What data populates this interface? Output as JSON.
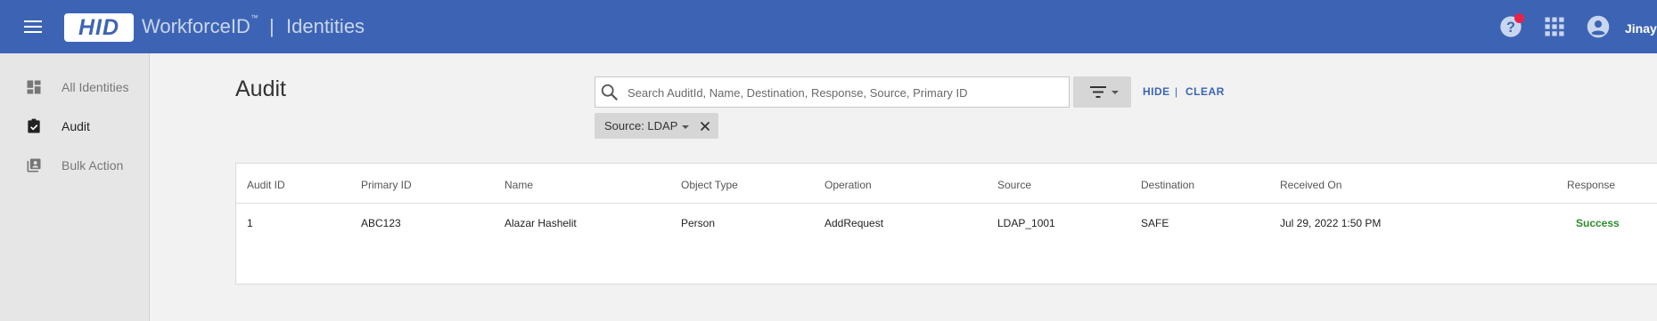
{
  "header": {
    "brand_logo": "HID",
    "product_name": "WorkforceID",
    "trademark": "™",
    "separator": "|",
    "section_title": "Identities",
    "username": "Jinay",
    "icons": [
      "menu-icon",
      "help-icon",
      "apps-grid-icon",
      "account-circle-icon"
    ],
    "notification_color": "#e8234a",
    "bar_color": "#3d64b4"
  },
  "sidebar": {
    "items": [
      {
        "label": "All Identities",
        "icon": "dashboard-icon",
        "active": false
      },
      {
        "label": "Audit",
        "icon": "clipboard-check-icon",
        "active": true
      },
      {
        "label": "Bulk Action",
        "icon": "contacts-icon",
        "active": false
      }
    ]
  },
  "main": {
    "title": "Audit",
    "search": {
      "placeholder": "Search AuditId, Name, Destination, Response, Source, Primary ID",
      "value": ""
    },
    "actions": {
      "hide": "HIDE",
      "separator": "|",
      "clear": "CLEAR"
    },
    "filter_chip": {
      "label": "Source: LDAP"
    },
    "table": {
      "columns": [
        "Audit ID",
        "Primary ID",
        "Name",
        "Object Type",
        "Operation",
        "Source",
        "Destination",
        "Received On",
        "Response"
      ],
      "rows": [
        [
          "1",
          "ABC123",
          "Alazar Hashelit",
          "Person",
          "AddRequest",
          "LDAP_1001",
          "SAFE",
          "Jul 29, 2022 1:50 PM",
          "Success"
        ]
      ],
      "success_color": "#2e8b2e"
    }
  }
}
